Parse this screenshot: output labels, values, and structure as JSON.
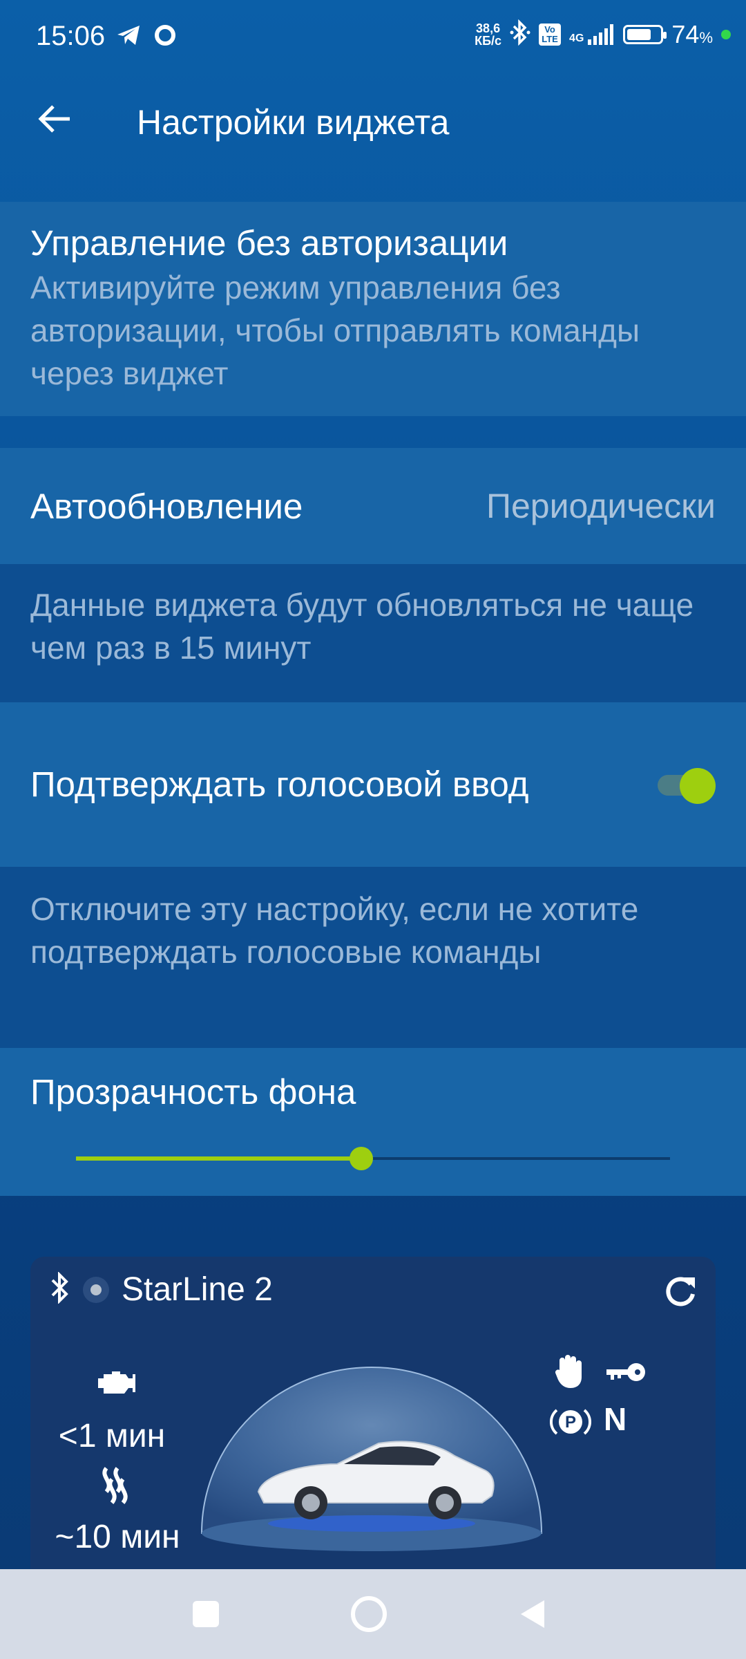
{
  "status_bar": {
    "time": "15:06",
    "net_speed_value": "38,6",
    "net_speed_unit": "КБ/с",
    "volte_label": "Vo LTE",
    "network_type": "4G",
    "battery_pct": "74",
    "battery_sign": "%",
    "battery_level": 0.74
  },
  "app_bar": {
    "title": "Настройки виджета"
  },
  "settings": {
    "no_auth": {
      "title": "Управление без авторизации",
      "desc": "Активируйте режим управления без авторизации, чтобы отправлять команды через виджет"
    },
    "auto_update": {
      "title": "Автообновление",
      "value": "Периодически",
      "desc": "Данные виджета будут обновляться не чаще чем раз в 15 минут"
    },
    "voice_confirm": {
      "title": "Подтверждать голосовой ввод",
      "enabled": true,
      "desc": "Отключите эту настройку, если не хотите подтверждать голосовые команды"
    },
    "transparency": {
      "title": "Прозрачность фона",
      "value_fraction": 0.48
    }
  },
  "widget": {
    "device_name": "StarLine 2",
    "engine_timer": "<1 мин",
    "heater_timer": "~10 мин",
    "gear_label": "N",
    "icons": [
      "bluetooth-icon",
      "refresh-icon",
      "engine-icon",
      "heater-icon",
      "hand-icon",
      "key-icon",
      "parking-icon"
    ]
  },
  "colors": {
    "accent": "#9ecf0f",
    "bg_top": "#0b5fa8",
    "bg_bottom": "#0a3a73",
    "widget_bg": "#15386d",
    "nav_bar": "#d5dbe6"
  }
}
